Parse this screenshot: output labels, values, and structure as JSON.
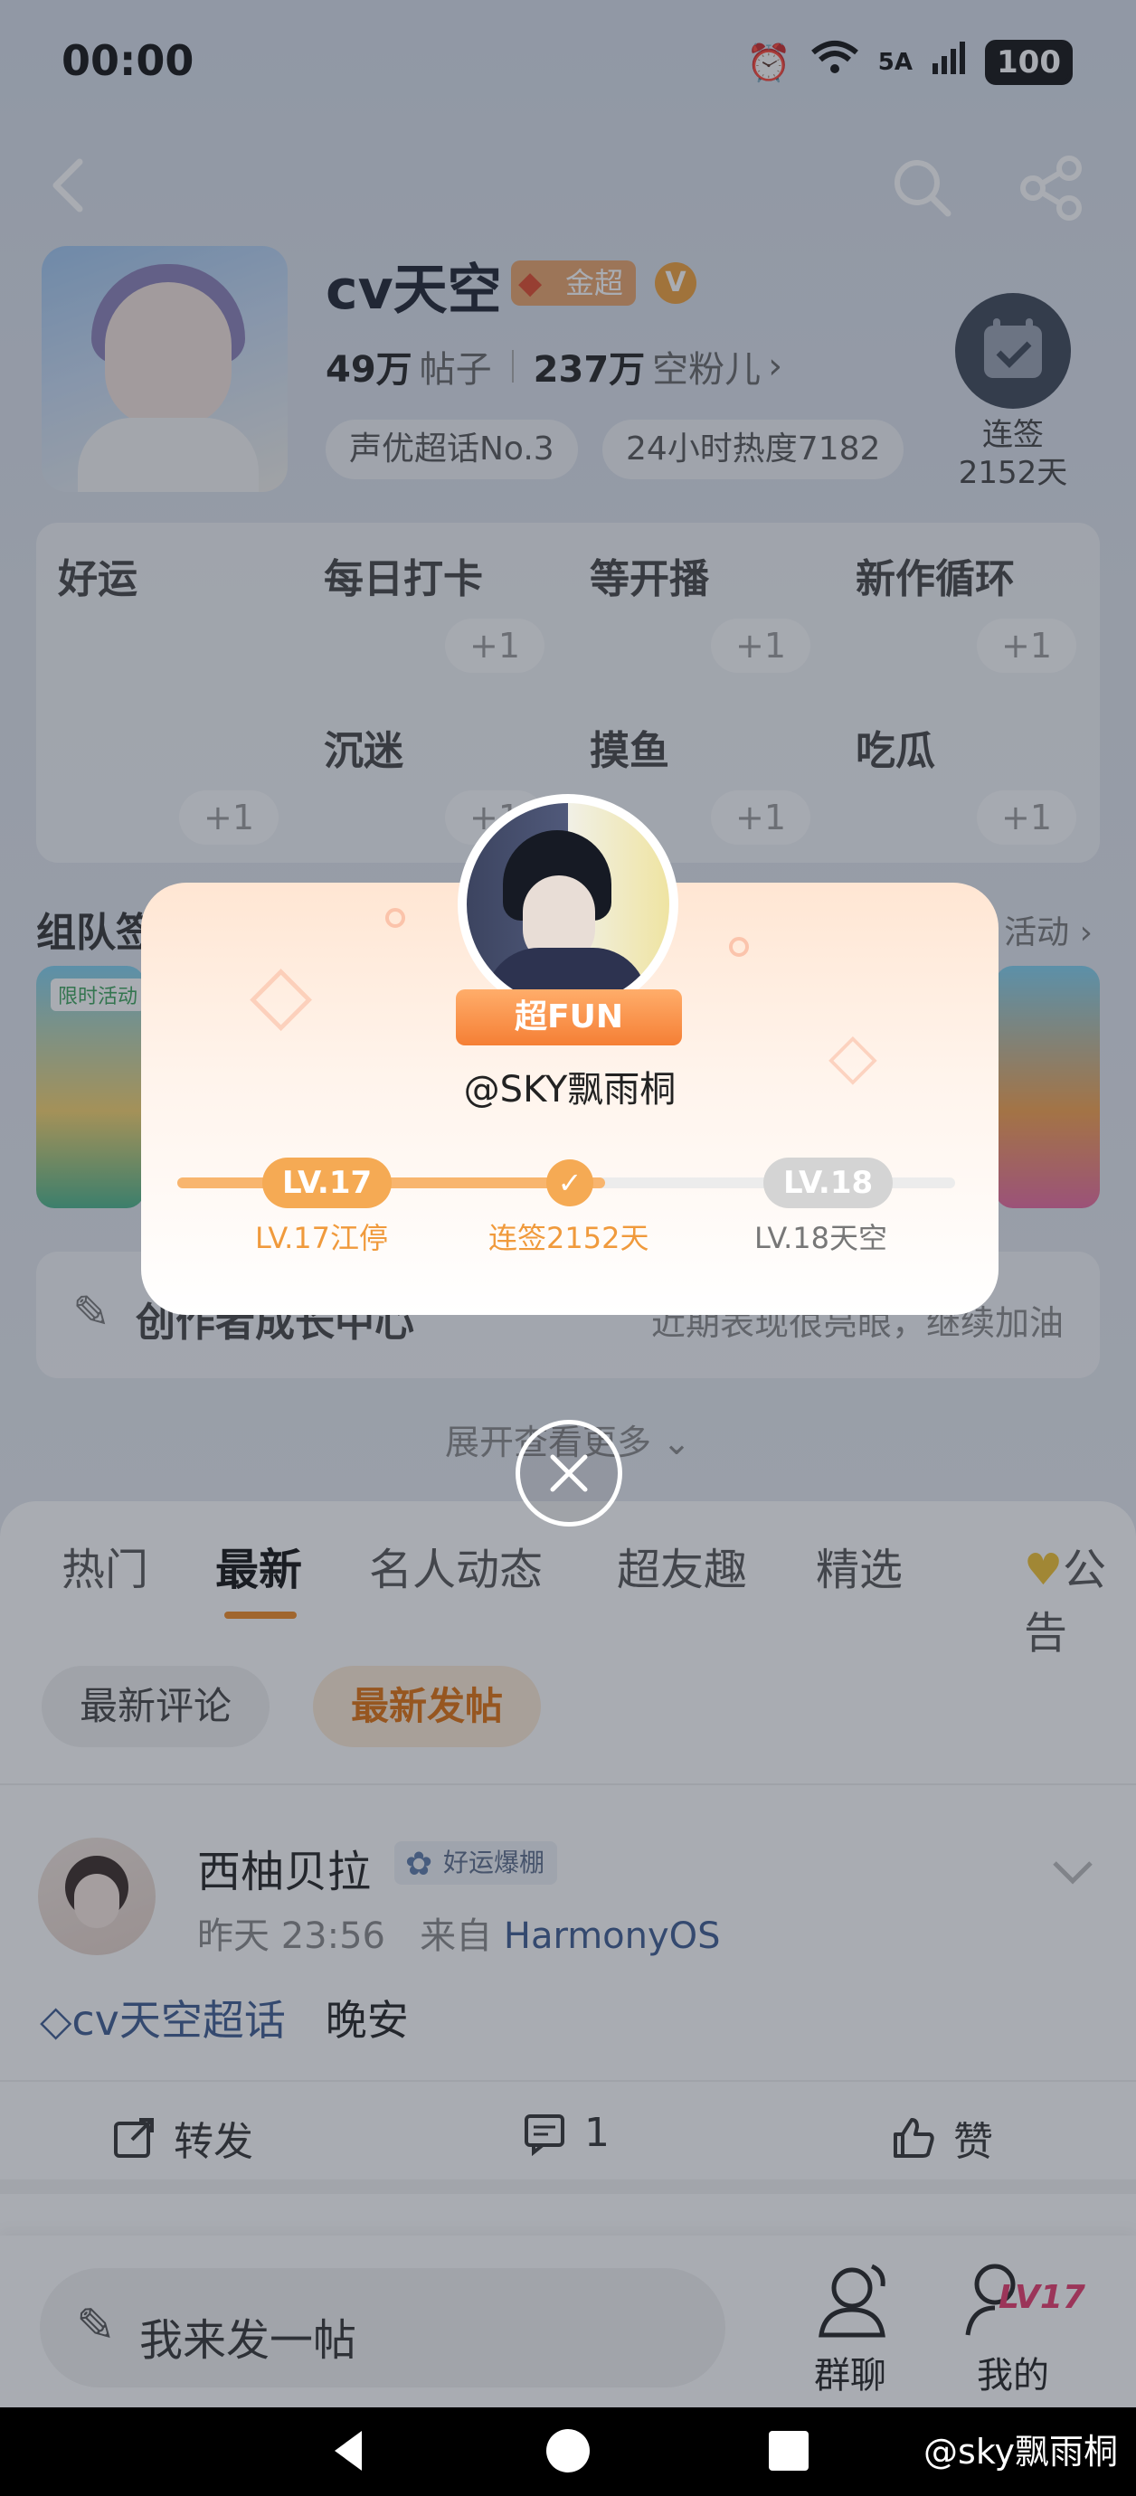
{
  "status_bar": {
    "time": "00:00",
    "network": "5A",
    "battery": "100"
  },
  "header": {
    "title": "cv天空",
    "badge": "金超",
    "verified": "V",
    "posts_num": "49万",
    "posts_unit": "帖子",
    "fans_num": "237万",
    "fans_unit": "空粉儿",
    "tags": [
      "声优超话No.3",
      "24小时热度7182"
    ],
    "checkin_label": "连签",
    "checkin_days": "2152天"
  },
  "grid": {
    "side_label": "好运",
    "cells": [
      {
        "label": "每日打卡",
        "plus": "+1"
      },
      {
        "label": "等开播",
        "plus": "+1"
      },
      {
        "label": "新作循环",
        "plus": "+1"
      },
      {
        "label": "沉迷",
        "plus": "+1"
      },
      {
        "label": "摸鱼",
        "plus": "+1"
      },
      {
        "label": "吃瓜",
        "plus": "+1"
      }
    ],
    "side_plus": "+1"
  },
  "team_section": {
    "title": "组队签",
    "link": "活动",
    "limited": "限时活动"
  },
  "growth": {
    "label": "创作者成长中心",
    "note": "近期表现很亮眼，继续加油"
  },
  "expand": "展开查看更多",
  "tabs": [
    "热门",
    "最新",
    "名人动态",
    "超友趣",
    "精选",
    "公告"
  ],
  "pills": [
    "最新评论",
    "最新发帖"
  ],
  "post": {
    "author": "西柚贝拉",
    "badge": "好运爆棚",
    "time": "昨天 23:56",
    "from": "来自",
    "source": "HarmonyOS",
    "topic": "cv天空超话",
    "text": "晚安",
    "repost": "转发",
    "comments": "1",
    "like": "赞"
  },
  "bottom_bar": {
    "compose": "我来发一帖",
    "group_chat": "群聊",
    "mine": "我的",
    "mine_level": "LV17"
  },
  "watermark": "@sky飘雨桐",
  "modal": {
    "ribbon": "超FUN",
    "user": "@SKY飘雨桐",
    "current_level": "LV.17",
    "next_level": "LV.18",
    "current_caption": "LV.17江停",
    "mid_caption": "连签2152天",
    "next_caption": "LV.18天空",
    "progress": 0.55
  },
  "colors": {
    "accent": "#f5aa54",
    "accent_text": "#f09a3c",
    "link": "#3c5b8f",
    "tab_underline": "#f08a24"
  }
}
